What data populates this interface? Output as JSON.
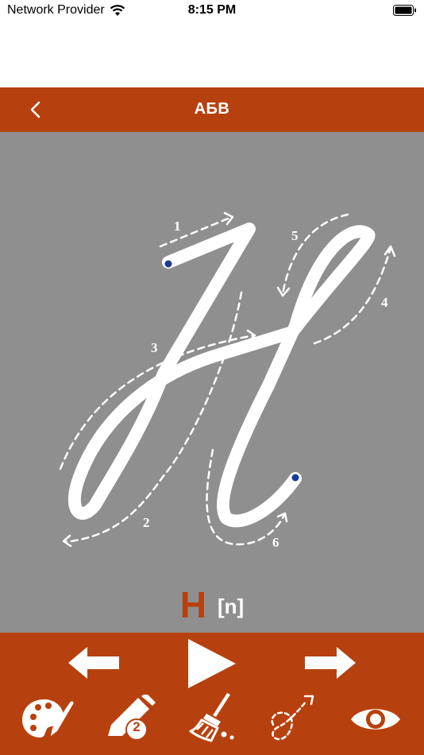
{
  "status": {
    "carrier": "Network Provider",
    "time": "8:15 PM"
  },
  "nav": {
    "title": "АБВ",
    "back_icon": "chevron-left-icon"
  },
  "letter": {
    "glyph": "Н",
    "transcription": "[n]",
    "stroke_numbers": [
      "1",
      "2",
      "3",
      "4",
      "5",
      "6"
    ]
  },
  "colors": {
    "accent": "#b7410e",
    "canvas": "#8f8f8f",
    "stroke": "#ffffff",
    "start_dot": "#1a3a9c"
  },
  "toolbar": {
    "icons": [
      "arrow-left-icon",
      "play-icon",
      "arrow-right-icon",
      "palette-icon",
      "pencil-icon",
      "broom-icon",
      "dotted-path-icon",
      "eye-icon"
    ],
    "pencil_badge": "2"
  }
}
